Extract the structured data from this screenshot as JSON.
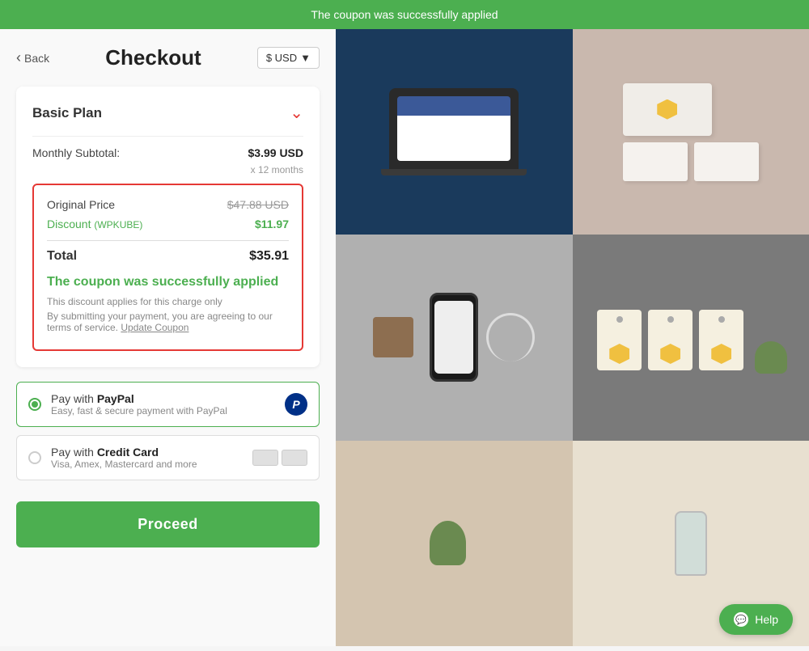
{
  "notification": {
    "message": "The coupon was successfully applied"
  },
  "header": {
    "back_label": "Back",
    "title": "Checkout",
    "currency": "$ USD",
    "currency_arrow": "▼"
  },
  "plan": {
    "name": "Basic Plan",
    "chevron": "⌄",
    "monthly_subtotal_label": "Monthly Subtotal:",
    "monthly_subtotal_value": "$3.99 USD",
    "months_note": "x 12 months",
    "original_price_label": "Original Price",
    "original_price_value": "$47.88 USD",
    "discount_label": "Discount",
    "discount_code": "(WPKUBE)",
    "discount_value": "$11.97",
    "total_label": "Total",
    "total_value": "$35.91",
    "coupon_success_title": "The coupon was successfully applied",
    "coupon_note_1": "This discount applies for this charge only",
    "coupon_note_2": "By submitting your payment, you are agreeing to our terms of service.",
    "update_coupon_label": "Update Coupon"
  },
  "payment": {
    "paypal_label": "Pay with PayPal",
    "paypal_sublabel": "Easy, fast & secure payment with PayPal",
    "credit_label": "Pay with Credit Card",
    "credit_sublabel": "Visa, Amex, Mastercard and more",
    "paypal_selected": true
  },
  "proceed": {
    "label": "Proceed"
  },
  "help": {
    "label": "Help"
  }
}
